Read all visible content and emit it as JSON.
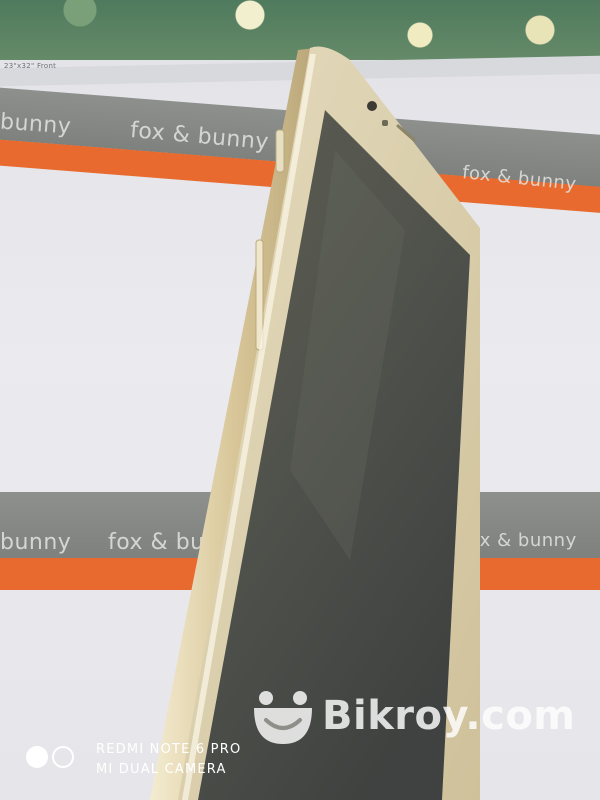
{
  "scene": {
    "subject": "Gold smartphone lying on its side, screen off, on printed paper board"
  },
  "background_text": {
    "fine_print": "23\"x32\"   Front",
    "band_top_left": "bunny",
    "band_top_mid": "fox & bunny",
    "band_top_right": "fox & bunny",
    "band_bottom_left": "bunny",
    "band_bottom_mid": "fox & bu",
    "band_bottom_right": "fox & bunny"
  },
  "watermark": {
    "text": "Bikroy.com",
    "icon": "smiley-bag-icon"
  },
  "camera_stamp": {
    "line1": "REDMI NOTE 6 PRO",
    "line2": "MI DUAL CAMERA"
  },
  "colors": {
    "phone_frame": "#d9c79a",
    "band_orange": "#e86a2e",
    "band_grey": "#878a87",
    "screen": "#4a4c48"
  }
}
